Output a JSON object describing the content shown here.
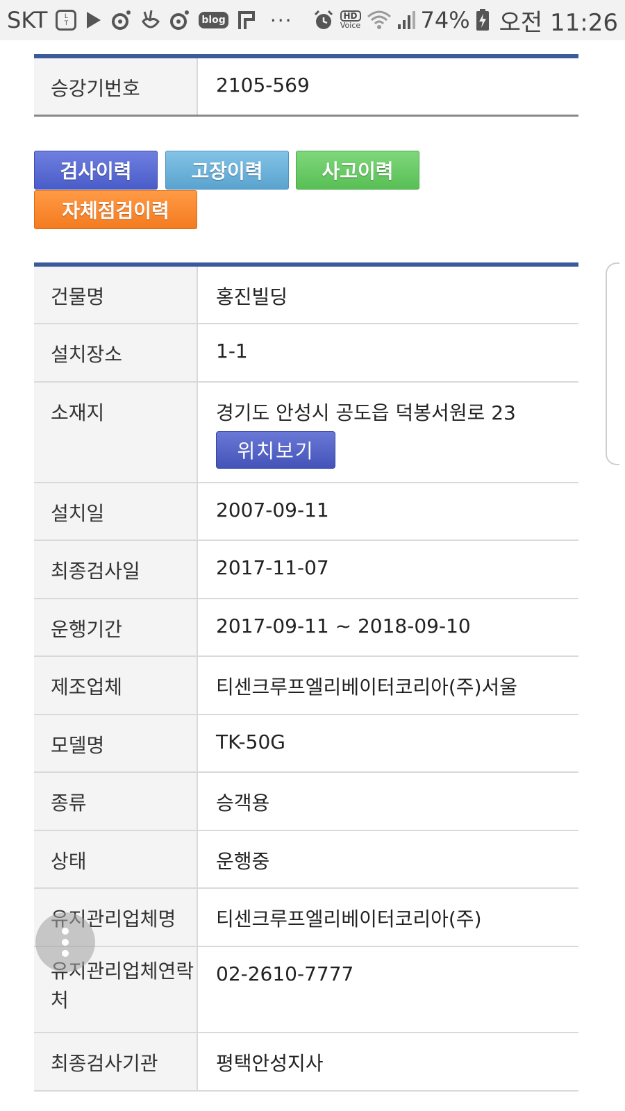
{
  "status_bar": {
    "carrier": "SKT",
    "icons": [
      "lotte-ting-icon",
      "play-store-icon",
      "music-note-icon",
      "v-live-icon",
      "music-note-icon",
      "blog-icon",
      "flag-icon"
    ],
    "blog_label": "blog",
    "overflow": "···",
    "hd_label": "HD",
    "hd_sub": "Voice",
    "battery_percent": "74%",
    "time": "오전 11:26"
  },
  "elevator": {
    "number_label": "승강기번호",
    "number_value": "2105-569"
  },
  "history_buttons": {
    "inspection": "검사이력",
    "fault": "고장이력",
    "accident": "사고이력",
    "self_check": "자체점검이력"
  },
  "details": [
    {
      "label": "건물명",
      "value": "홍진빌딩"
    },
    {
      "label": "설치장소",
      "value": "1-1"
    },
    {
      "label": "소재지",
      "value": "경기도 안성시 공도읍 덕봉서원로 23"
    },
    {
      "label": "설치일",
      "value": "2007-09-11"
    },
    {
      "label": "최종검사일",
      "value": "2017-11-07"
    },
    {
      "label": "운행기간",
      "value": "2017-09-11 ~ 2018-09-10"
    },
    {
      "label": "제조업체",
      "value": "티센크루프엘리베이터코리아(주)서울"
    },
    {
      "label": "모델명",
      "value": "TK-50G"
    },
    {
      "label": "종류",
      "value": "승객용"
    },
    {
      "label": "상태",
      "value": "운행중"
    },
    {
      "label": "유지관리업체명",
      "value": "티센크루프엘리베이터코리아(주)"
    },
    {
      "label": "유지관리업체연락처",
      "value": "02-2610-7777"
    },
    {
      "label": "최종검사기관",
      "value": "평택안성지사"
    }
  ],
  "location_button": "위치보기",
  "colors": {
    "header_rule": "#3b5a9a",
    "inspection": "#4a5cc8",
    "fault": "#5aa3cf",
    "accident": "#58bf55",
    "self_check": "#f47b20"
  }
}
